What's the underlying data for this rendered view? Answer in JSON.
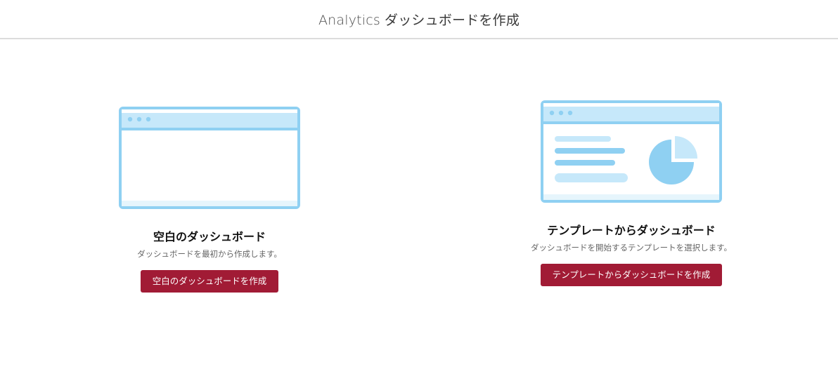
{
  "header": {
    "brand": "Analytics",
    "title": "ダッシュボードを作成"
  },
  "options": [
    {
      "title": "空白のダッシュボード",
      "description": "ダッシュボードを最初から作成します。",
      "button_label": "空白のダッシュボードを作成"
    },
    {
      "title": "テンプレートからダッシュボード",
      "description": "ダッシュボードを開始するテンプレートを選択します。",
      "button_label": "テンプレートからダッシュボードを作成"
    }
  ],
  "colors": {
    "accent": "#a11b35",
    "illustration_stroke": "#8fd0f2",
    "illustration_fill": "#c6e8fa",
    "header_border": "#dcdcdc"
  }
}
